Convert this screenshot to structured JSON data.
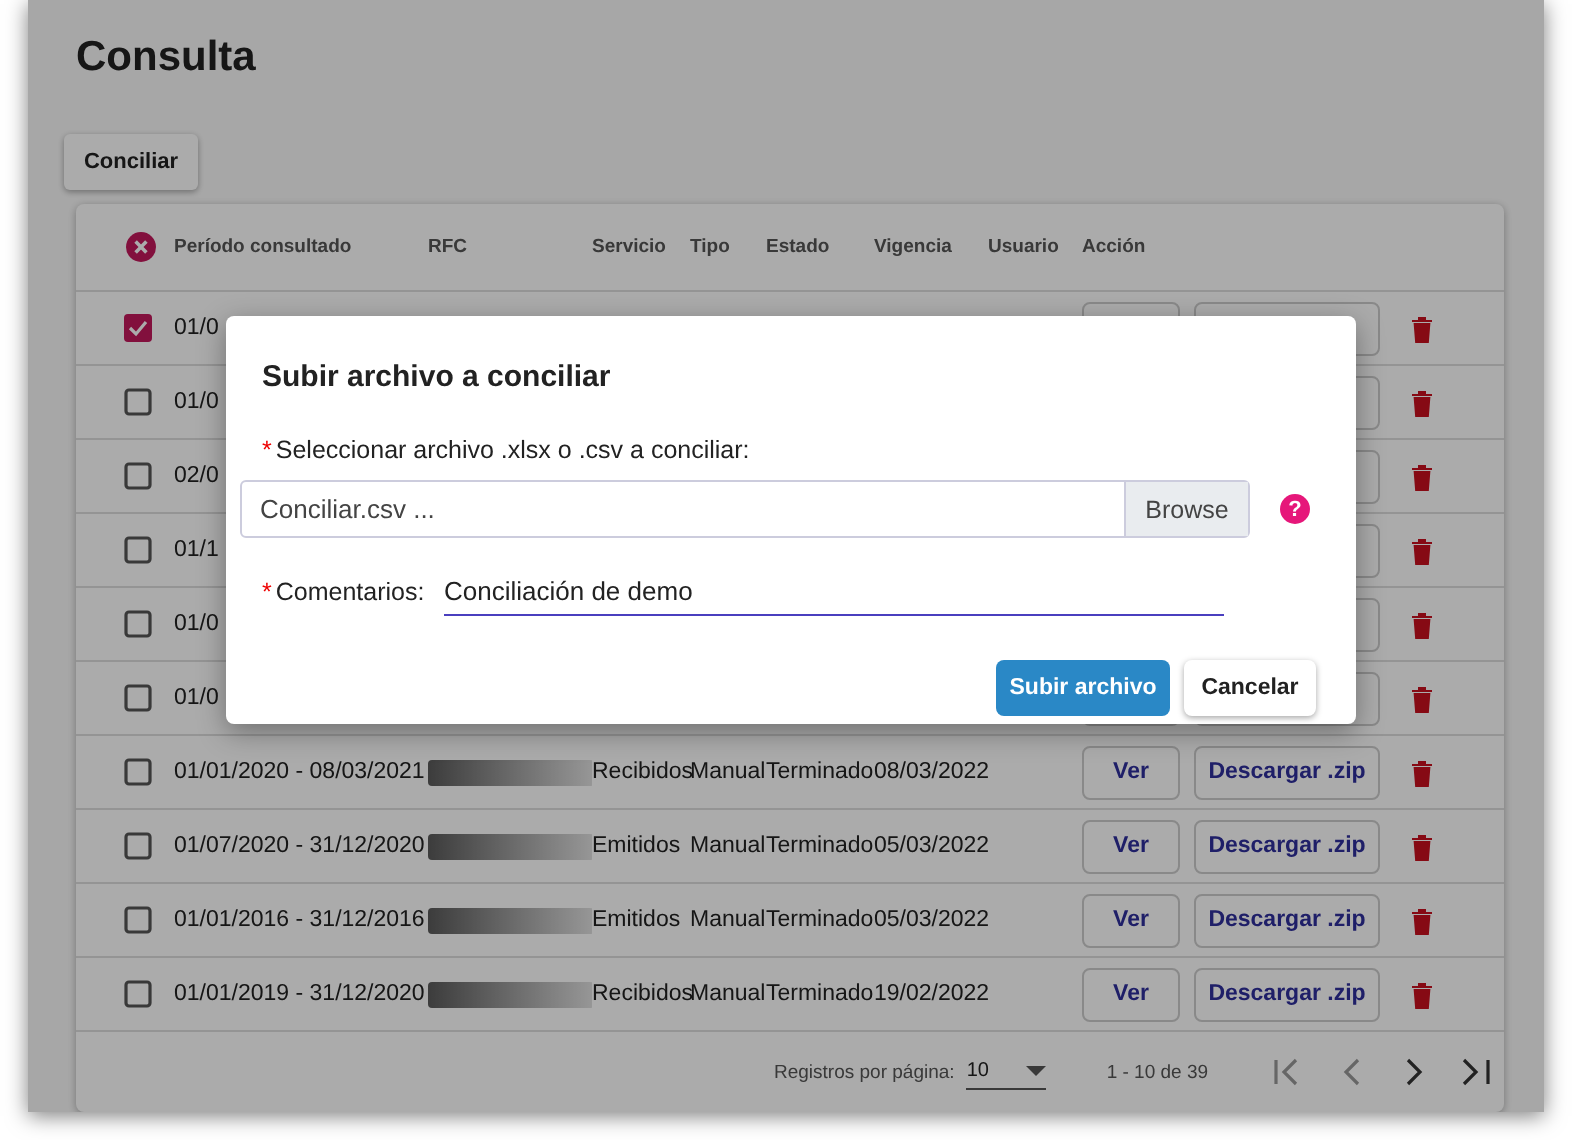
{
  "page": {
    "title": "Consulta",
    "conciliar_button": "Conciliar"
  },
  "table": {
    "columns": [
      "Período consultado",
      "RFC",
      "Servicio",
      "Tipo",
      "Estado",
      "Vigencia",
      "Usuario",
      "Acción"
    ],
    "rows": [
      {
        "checked": true,
        "period": "01/0"
      },
      {
        "checked": false,
        "period": "01/0"
      },
      {
        "checked": false,
        "period": "02/0"
      },
      {
        "checked": false,
        "period": "01/1"
      },
      {
        "checked": false,
        "period": "01/0"
      },
      {
        "checked": false,
        "period": "01/0"
      },
      {
        "checked": false,
        "period": "01/01/2020 - 08/03/2021",
        "service": "Recibidos",
        "type": "Manual",
        "status": "Terminado",
        "validity": "08/03/2022",
        "view": "Ver",
        "download": "Descargar .zip"
      },
      {
        "checked": false,
        "period": "01/07/2020 - 31/12/2020",
        "service": "Emitidos",
        "type": "Manual",
        "status": "Terminado",
        "validity": "05/03/2022",
        "view": "Ver",
        "download": "Descargar .zip"
      },
      {
        "checked": false,
        "period": "01/01/2016 - 31/12/2016",
        "service": "Emitidos",
        "type": "Manual",
        "status": "Terminado",
        "validity": "05/03/2022",
        "view": "Ver",
        "download": "Descargar .zip"
      },
      {
        "checked": false,
        "period": "01/01/2019 - 31/12/2020",
        "service": "Recibidos",
        "type": "Manual",
        "status": "Terminado",
        "validity": "19/02/2022",
        "view": "Ver",
        "download": "Descargar .zip"
      }
    ],
    "pagination": {
      "rows_per_page_label": "Registros por página:",
      "rows_per_page": "10",
      "range": "1 - 10 de 39"
    }
  },
  "dialog": {
    "title": "Subir archivo a conciliar",
    "file_field": {
      "required_mark": "*",
      "label": "Seleccionar archivo .xlsx o .csv a conciliar:",
      "value": "Conciliar.csv ...",
      "browse": "Browse",
      "help": "?"
    },
    "comments_field": {
      "required_mark": "*",
      "label": "Comentarios:",
      "value": "Conciliación de demo"
    },
    "buttons": [
      {
        "label": "Subir archivo",
        "kind": "primary"
      },
      {
        "label": "Cancelar",
        "kind": "secondary"
      }
    ]
  }
}
